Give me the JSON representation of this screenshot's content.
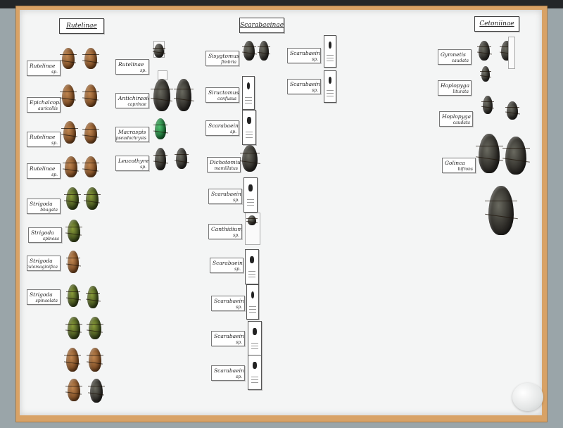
{
  "headers": {
    "rutelinae": "Rutelinae",
    "scarabaeinae": "Scarabaeinae",
    "cetoniinae": "Cetoniinae"
  },
  "labels": [
    {
      "a": "Rutelinae",
      "b": "sp."
    },
    {
      "a": "Epichalcoplethis",
      "b": "auricollis"
    },
    {
      "a": "Rutelinae",
      "b": "sp."
    },
    {
      "a": "Rutelinae",
      "b": "sp."
    },
    {
      "a": "Strigoda",
      "b": "bhagata"
    },
    {
      "a": "Strigoda",
      "b": "spinosa"
    },
    {
      "a": "Strigoda",
      "b": "parvasculomaginifica"
    },
    {
      "a": "Strigoda",
      "b": "spinaolata"
    },
    {
      "a": "Rutelinae",
      "b": "sp."
    },
    {
      "a": "Antichiraoides",
      "b": "caprinae"
    },
    {
      "a": "Macraspis",
      "b": "pseudochrysis"
    },
    {
      "a": "Leucothyreus",
      "b": "sp."
    },
    {
      "a": "Sisygtomus",
      "b": "fimbria"
    },
    {
      "a": "Siructomus",
      "b": "confusus"
    },
    {
      "a": "Scarabaeinae",
      "b": "sp."
    },
    {
      "a": "Dichotomius",
      "b": "mamillatus"
    },
    {
      "a": "Scarabaeinae",
      "b": "sp."
    },
    {
      "a": "Canthidium",
      "b": "sp."
    },
    {
      "a": "Scarabaeinae",
      "b": "sp."
    },
    {
      "a": "Scarabaeinae",
      "b": "sp."
    },
    {
      "a": "Scarabaeinae",
      "b": "sp."
    },
    {
      "a": "Scarabaeinae",
      "b": "sp."
    },
    {
      "a": "Scarabaeinae",
      "b": "sp."
    },
    {
      "a": "Scarabaeinae",
      "b": "sp."
    },
    {
      "a": "Gymnetis",
      "b": "caudata"
    },
    {
      "a": "Hoplopyga",
      "b": "liturata"
    },
    {
      "a": "Hoplopyga",
      "b": "caudata"
    },
    {
      "a": "Golinca",
      "b": "bifrons"
    }
  ],
  "specimen_colors": {
    "bronze": "#9a6634",
    "dark": "#2a2824",
    "green": "#3c4a1a",
    "emerald": "#1a6b33"
  }
}
